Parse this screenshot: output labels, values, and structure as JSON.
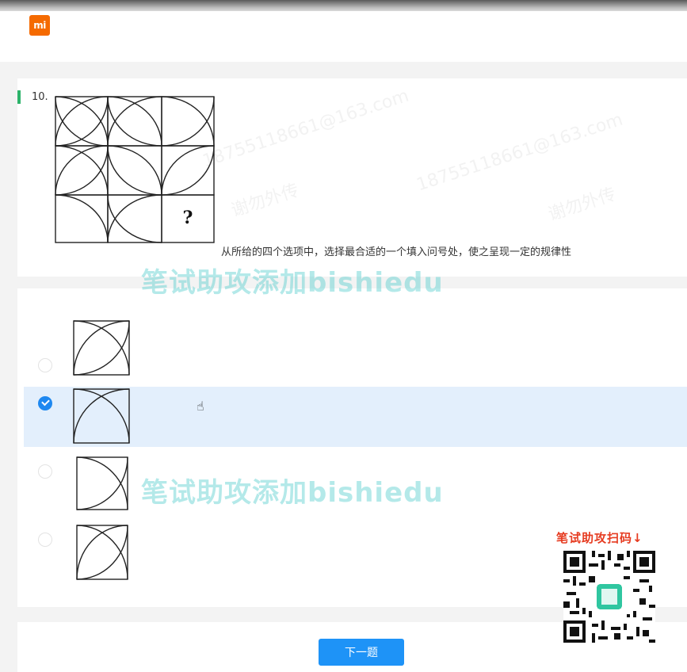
{
  "header": {
    "logo_text": "mi",
    "brand_color": "#f56a00"
  },
  "question": {
    "number": "10.",
    "prompt": "从所给的四个选项中，选择最合适的一个填入问号处，使之呈现一定的规律性",
    "unknown_cell_symbol": "?"
  },
  "options": [
    {
      "id": "A",
      "selected": false
    },
    {
      "id": "B",
      "selected": true
    },
    {
      "id": "C",
      "selected": false
    },
    {
      "id": "D",
      "selected": false
    }
  ],
  "footer": {
    "next_button_label": "下一题"
  },
  "overlay": {
    "watermark_text_1": "笔试助攻添加bishiedu",
    "watermark_text_2": "笔试助攻添加bishiedu",
    "qr_label": "笔试助攻扫码↓",
    "faint_watermarks": [
      "18755118661@163.com",
      "18755118661@163.com",
      "谢勿外传",
      "谢勿外传"
    ]
  },
  "colors": {
    "accent_green": "#2db36a",
    "primary_blue": "#1e93f7",
    "selected_bg": "#e3effc"
  }
}
